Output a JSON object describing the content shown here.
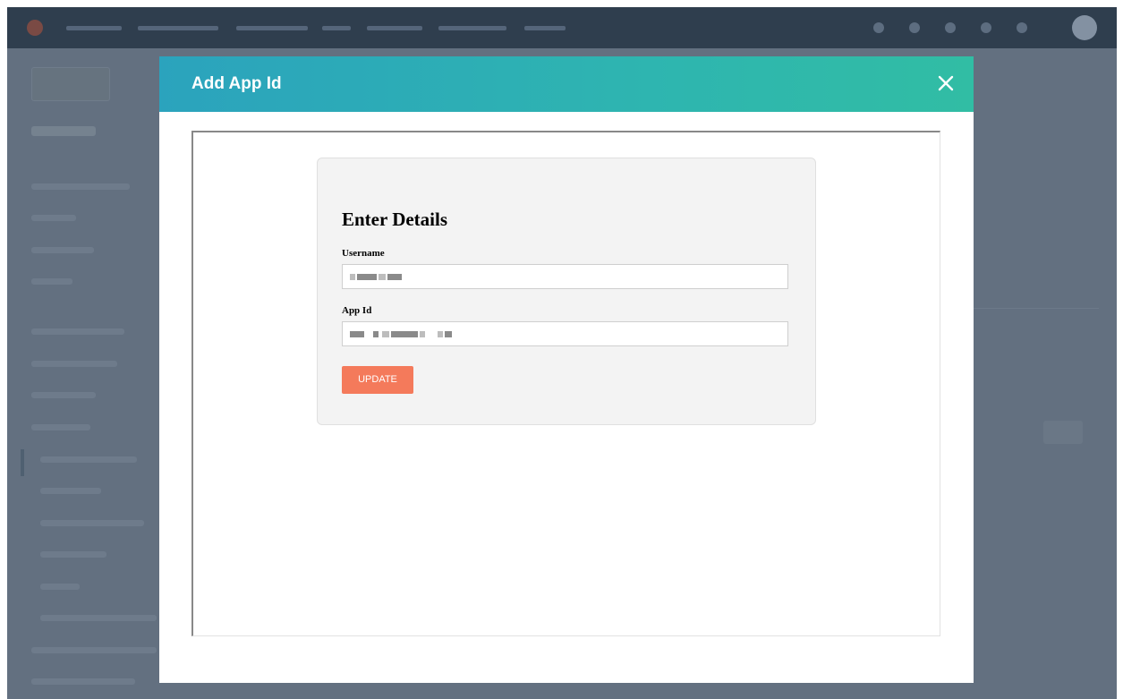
{
  "modal": {
    "title": "Add App Id",
    "close_icon": "close-icon"
  },
  "form": {
    "heading": "Enter Details",
    "username_label": "Username",
    "username_value": "",
    "app_id_label": "App Id",
    "app_id_value": "",
    "update_label": "UPDATE"
  },
  "colors": {
    "header_gradient_start": "#2ba3bd",
    "header_gradient_end": "#31bda4",
    "update_button": "#f47a5b",
    "overlay": "#637080",
    "top_nav": "#2f3e4e"
  }
}
